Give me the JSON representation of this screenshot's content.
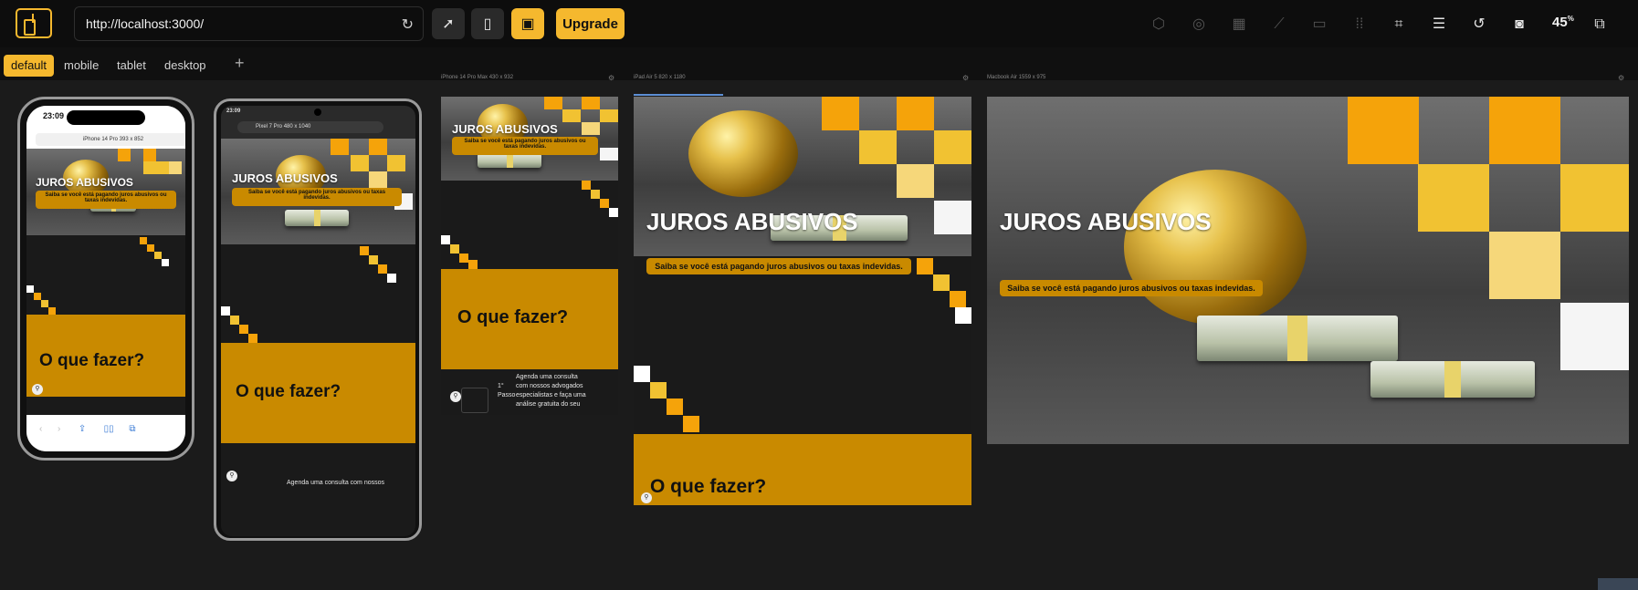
{
  "toolbar": {
    "url": "http://localhost:3000/",
    "upgrade_label": "Upgrade",
    "zoom_value": "45",
    "zoom_unit": "%"
  },
  "tabs": [
    {
      "label": "default",
      "active": true
    },
    {
      "label": "mobile",
      "active": false
    },
    {
      "label": "tablet",
      "active": false
    },
    {
      "label": "desktop",
      "active": false
    }
  ],
  "icons": {
    "left_tools": [
      "pointer-icon",
      "touch-icon",
      "devices-icon"
    ],
    "right_tools": [
      "cube-icon",
      "layers-icon",
      "grid-icon",
      "ruler-icon",
      "minus-icon",
      "dots-grid-icon",
      "focus-icon",
      "stack-icon",
      "rotate-icon",
      "camera-icon",
      "copy-icon"
    ]
  },
  "colors": {
    "accent": "#f5b82e",
    "brand_gold": "#c98a00",
    "dark_bg": "#1a1a1a"
  },
  "devices": [
    {
      "id": "iphone14pro",
      "label": "iPhone 14 Pro",
      "size": "393 x 852",
      "time": "23:09",
      "address_left": "AA"
    },
    {
      "id": "pixel7pro",
      "label": "Pixel 7 Pro",
      "size": "480 x 1040",
      "time": "23:09"
    },
    {
      "id": "iphone14promax",
      "label": "iPhone 14 Pro Max",
      "size": "430 x 932"
    },
    {
      "id": "ipadair5",
      "label": "iPad Air 5",
      "size": "820 x 1180"
    },
    {
      "id": "macbookair",
      "label": "Macbook Air",
      "size": "1559 x 975"
    }
  ],
  "site": {
    "hero_title": "JUROS ABUSIVOS",
    "hero_subtitle": "Saiba se você está pagando juros abusivos ou taxas indevidas.",
    "section_title": "O que fazer?",
    "step_number": "1°",
    "step_label": "Passo",
    "step_text": "Agenda uma consulta com nossos advogados especialistas e faça uma análise gratuita do seu",
    "step_text_short": "Agenda uma consulta com nossos"
  }
}
